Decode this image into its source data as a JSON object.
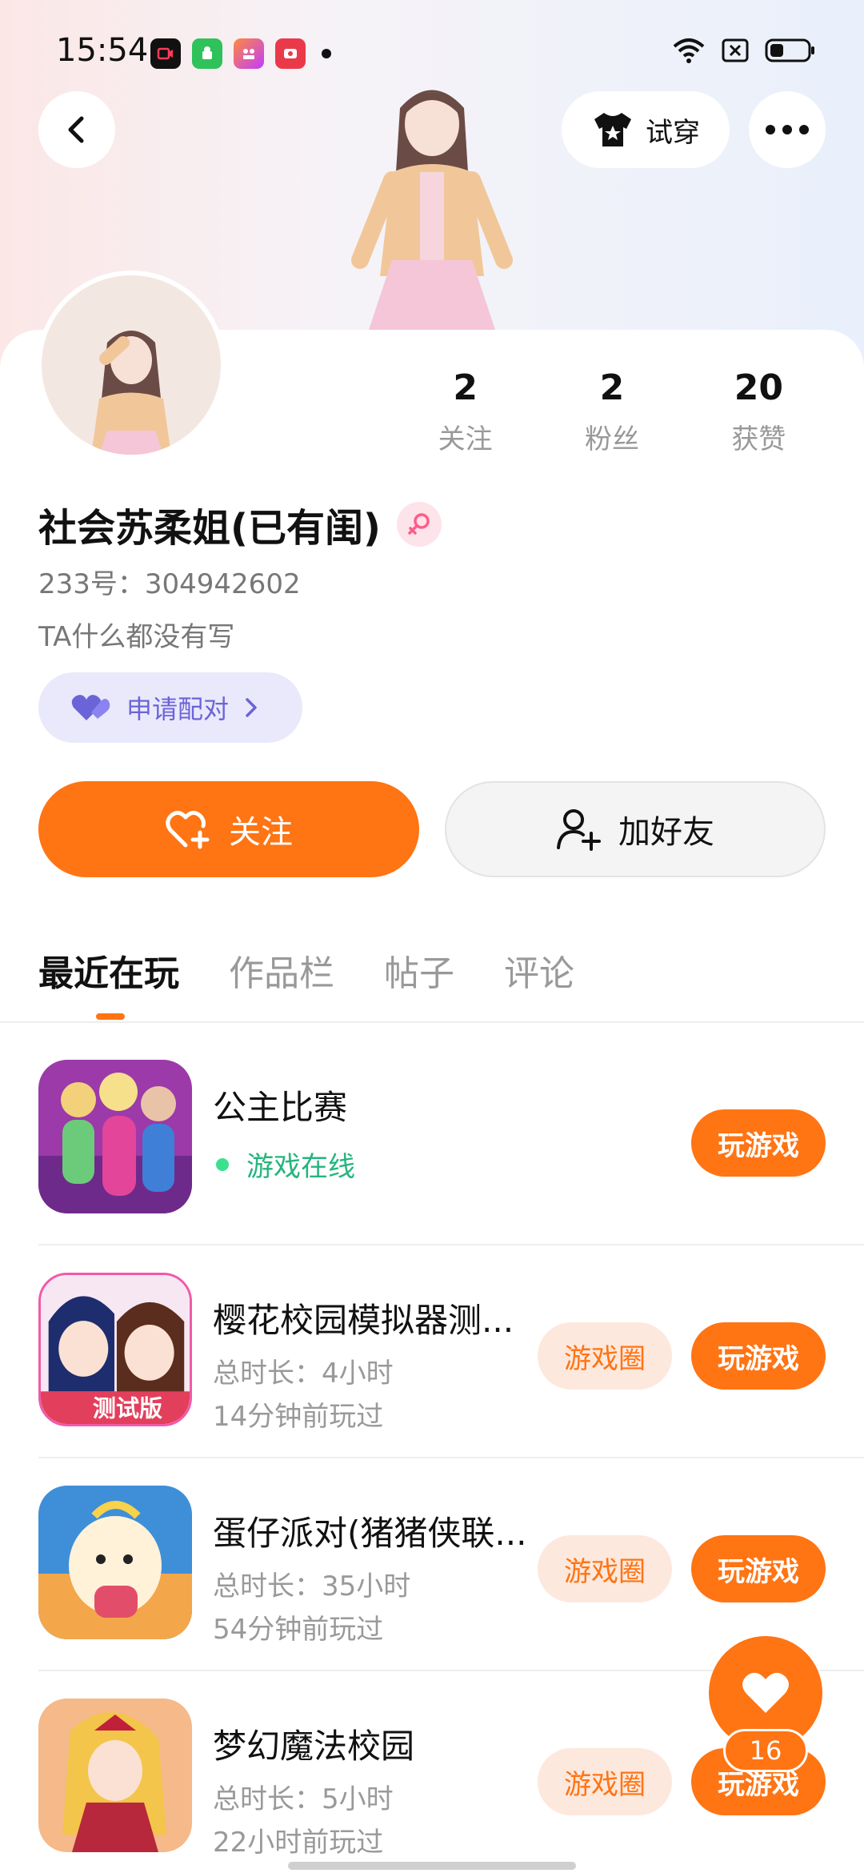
{
  "status_bar": {
    "time": "15:54",
    "apps": [
      "video-app",
      "android-app",
      "camera-app",
      "screen-record-app"
    ]
  },
  "header": {
    "try_on_label": "试穿"
  },
  "profile": {
    "following_count": "2",
    "following_label": "关注",
    "followers_count": "2",
    "followers_label": "粉丝",
    "likes_count": "20",
    "likes_label": "获赞",
    "username": "社会苏柔姐(已有闺)",
    "user_id": "233号：304942602",
    "bio": "TA什么都没有写",
    "pair_label": "申请配对"
  },
  "actions": {
    "follow_label": "关注",
    "add_friend_label": "加好友"
  },
  "tabs": [
    "最近在玩",
    "作品栏",
    "帖子",
    "评论"
  ],
  "games": [
    {
      "title": "公主比赛",
      "online": "游戏在线",
      "play": "玩游戏"
    },
    {
      "title": "樱花校园模拟器测...",
      "duration": "总时长：4小时",
      "last": "14分钟前玩过",
      "circle": "游戏圈",
      "play": "玩游戏",
      "icon_badge": "测试版"
    },
    {
      "title": "蛋仔派对(猪猪侠联...",
      "duration": "总时长：35小时",
      "last": "54分钟前玩过",
      "circle": "游戏圈",
      "play": "玩游戏"
    },
    {
      "title": "梦幻魔法校园",
      "duration": "总时长：5小时",
      "last": "22小时前玩过",
      "circle": "游戏圈",
      "play": "玩游戏"
    }
  ],
  "fab": {
    "count": "16"
  },
  "colors": {
    "accent": "#ff7413",
    "online": "#25b57e",
    "pair": "#6b64d8"
  }
}
